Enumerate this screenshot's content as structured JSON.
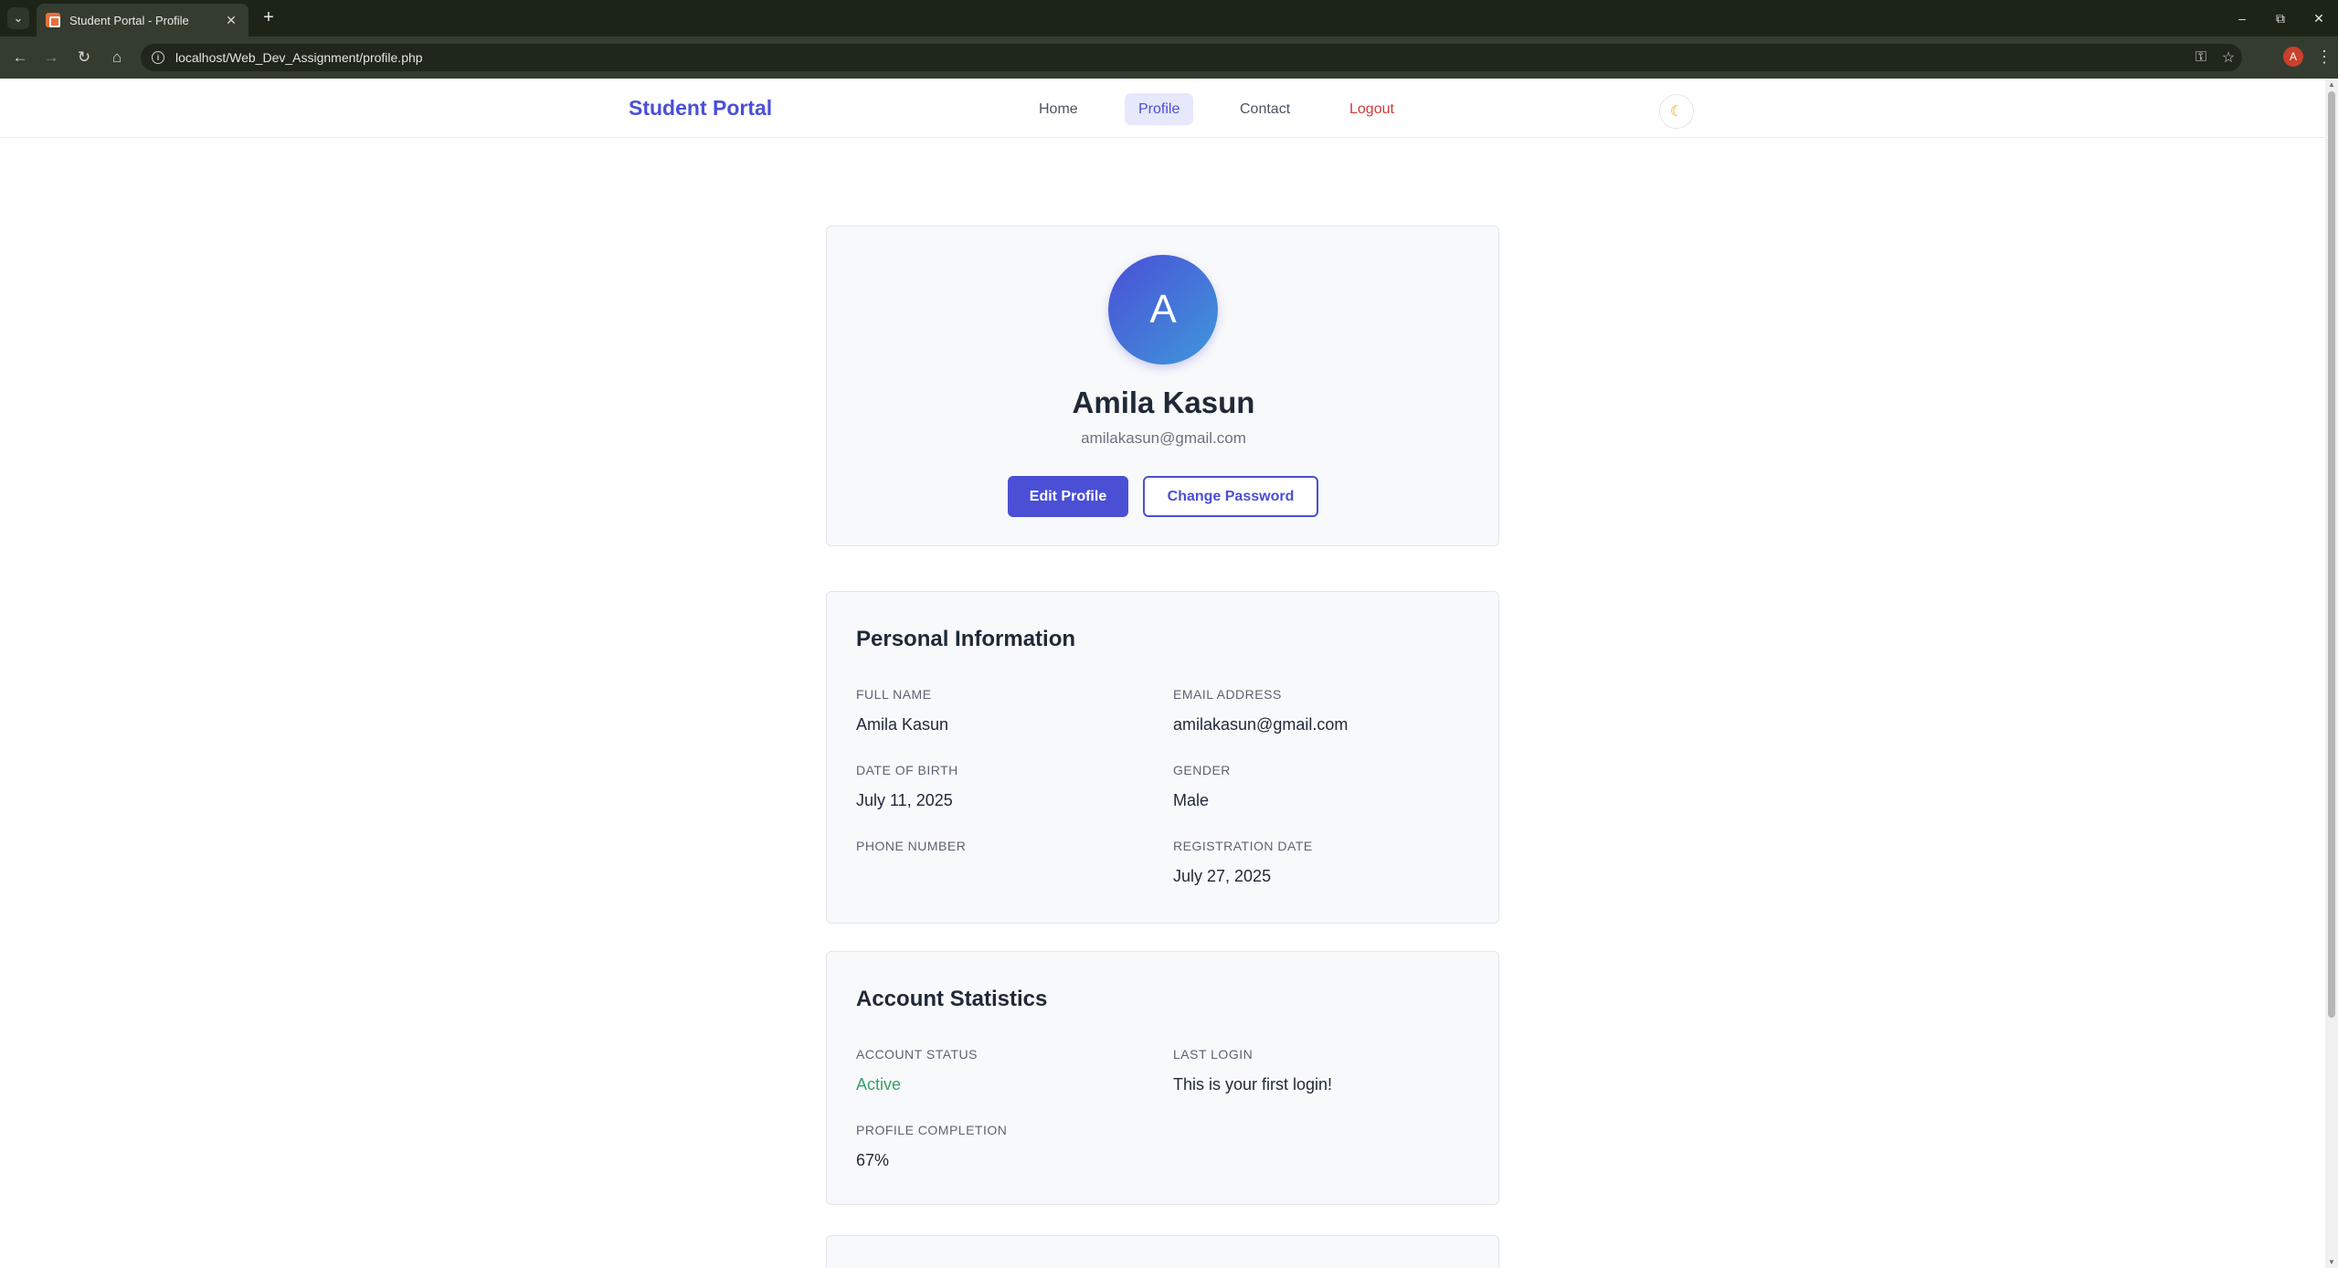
{
  "browser": {
    "tab_title": "Student Portal - Profile",
    "url": "localhost/Web_Dev_Assignment/profile.php",
    "profile_initial": "A"
  },
  "nav": {
    "brand": "Student Portal",
    "links": [
      {
        "label": "Home",
        "active": false
      },
      {
        "label": "Profile",
        "active": true
      },
      {
        "label": "Contact",
        "active": false
      },
      {
        "label": "Logout",
        "active": false
      }
    ],
    "theme_toggle_icon": "moon-icon"
  },
  "profile": {
    "initial": "A",
    "name": "Amila Kasun",
    "email": "amilakasun@gmail.com",
    "edit_button": "Edit Profile",
    "change_password_button": "Change Password"
  },
  "personal_info": {
    "title": "Personal Information",
    "fields": [
      {
        "label": "FULL NAME",
        "value": "Amila Kasun"
      },
      {
        "label": "EMAIL ADDRESS",
        "value": "amilakasun@gmail.com"
      },
      {
        "label": "DATE OF BIRTH",
        "value": "July 11, 2025"
      },
      {
        "label": "GENDER",
        "value": "Male"
      },
      {
        "label": "PHONE NUMBER",
        "value": ""
      },
      {
        "label": "REGISTRATION DATE",
        "value": "July 27, 2025"
      }
    ]
  },
  "account_stats": {
    "title": "Account Statistics",
    "fields": [
      {
        "label": "ACCOUNT STATUS",
        "value": "Active"
      },
      {
        "label": "LAST LOGIN",
        "value": "This is your first login!"
      },
      {
        "label": "PROFILE COMPLETION",
        "value": "67%"
      }
    ]
  },
  "colors": {
    "brand": "#4a4fd6",
    "logout": "#d23a3a",
    "active_status": "#38a169"
  }
}
